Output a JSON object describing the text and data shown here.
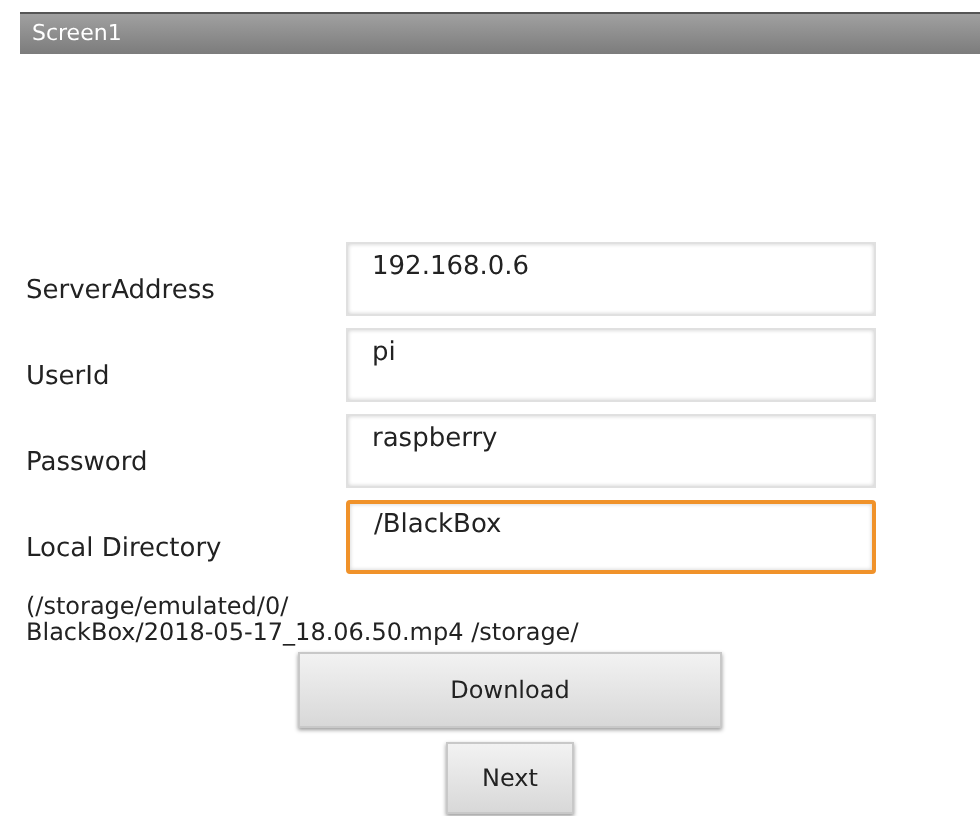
{
  "window": {
    "title": "Screen1"
  },
  "fields": [
    {
      "label": "ServerAddress",
      "value": "192.168.0.6",
      "focused": false
    },
    {
      "label": "UserId",
      "value": "pi",
      "focused": false
    },
    {
      "label": "Password",
      "value": "raspberry",
      "focused": false
    },
    {
      "label": "Local Directory",
      "value": "/BlackBox",
      "focused": true
    }
  ],
  "status_text": {
    "lines": [
      "(/storage/emulated/0/",
      "BlackBox/2018-05-17_18.06.50.mp4 /storage/"
    ]
  },
  "buttons": [
    {
      "label": "Download",
      "kind": "wide"
    },
    {
      "label": "Next",
      "kind": "narrow"
    }
  ]
}
